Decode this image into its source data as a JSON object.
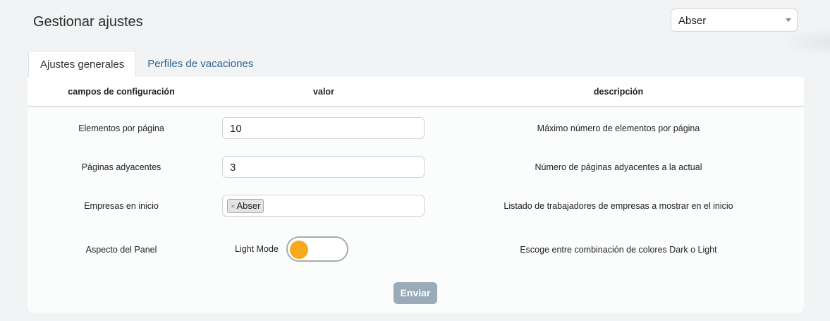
{
  "header": {
    "title": "Gestionar ajustes"
  },
  "company_select": {
    "value": "Abser"
  },
  "tabs": [
    {
      "label": "Ajustes generales",
      "active": true
    },
    {
      "label": "Perfiles de vacaciones",
      "active": false
    }
  ],
  "table": {
    "headers": [
      "campos de configuración",
      "valor",
      "descripción"
    ],
    "rows": [
      {
        "label": "Elementos por página",
        "value": "10",
        "description": "Máximo número de elementos por página"
      },
      {
        "label": "Páginas adyacentes",
        "value": "3",
        "description": "Número de páginas adyacentes a la actual"
      },
      {
        "label": "Empresas en inicio",
        "tags": [
          "Abser"
        ],
        "description": "Listado de trabajadores de empresas a mostrar en el inicio"
      },
      {
        "label": "Aspecto del Panel",
        "toggle_label": "Light Mode",
        "toggle_on": false,
        "description": "Escoge entre combinación de colores Dark o Light"
      }
    ]
  },
  "submit_label": "Enviar",
  "colors": {
    "accent_link": "#2d6497",
    "toggle_knob": "#f6a91c",
    "submit_bg": "#9aaab8"
  }
}
